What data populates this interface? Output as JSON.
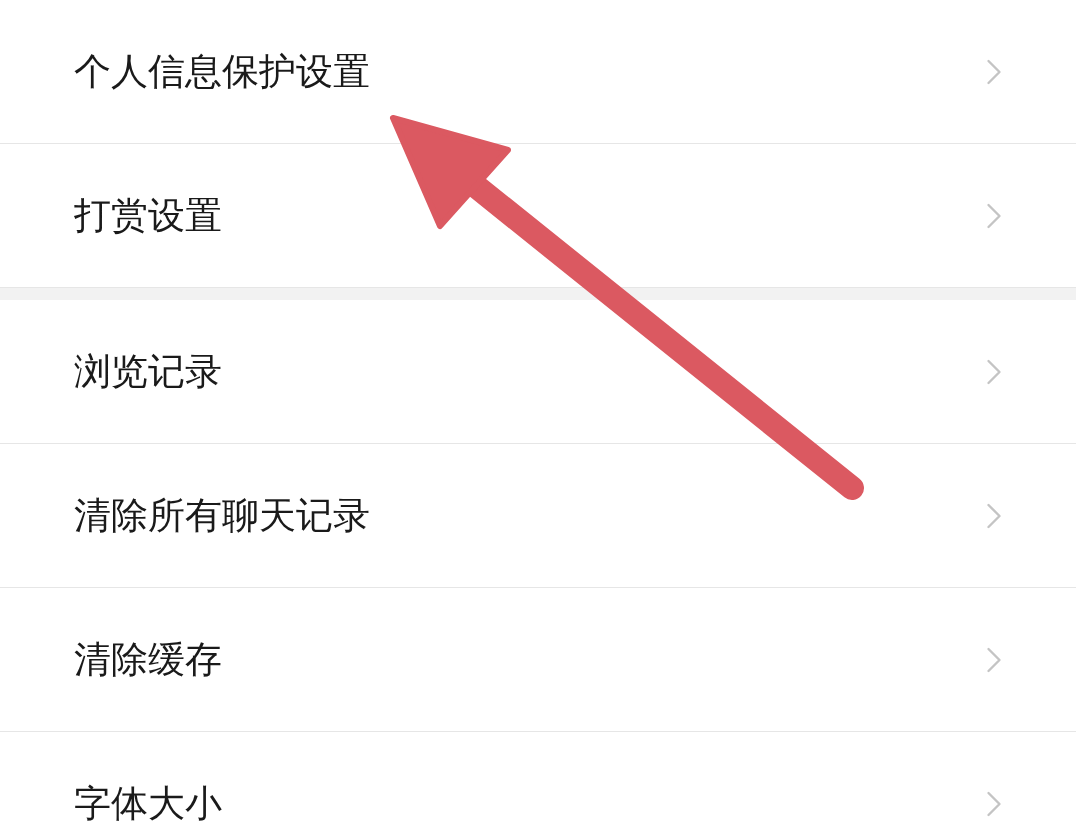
{
  "sections": [
    {
      "items": [
        {
          "label": "个人信息保护设置"
        },
        {
          "label": "打赏设置"
        }
      ]
    },
    {
      "items": [
        {
          "label": "浏览记录"
        },
        {
          "label": "清除所有聊天记录"
        },
        {
          "label": "清除缓存"
        },
        {
          "label": "字体大小"
        }
      ]
    }
  ]
}
